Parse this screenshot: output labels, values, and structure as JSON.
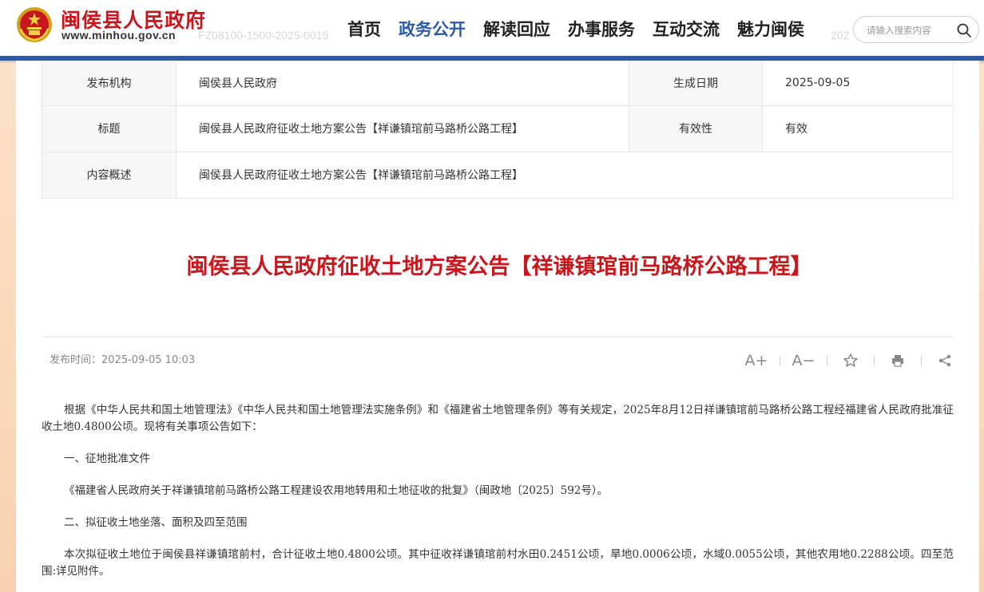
{
  "header": {
    "site_name": "闽侯县人民政府",
    "site_url": "www.minhou.gov.cn",
    "doc_ghost": "FZ08100-1500-2025-0015",
    "doc_ghost_right": "202",
    "nav": [
      "首页",
      "政务公开",
      "解读回应",
      "办事服务",
      "互动交流",
      "魅力闽侯"
    ],
    "active_nav": "政务公开",
    "search_placeholder": "请输入搜索内容",
    "brand_color": "#c8161d",
    "accent_color": "#2c5aa6"
  },
  "meta": {
    "publisher_label": "发布机构",
    "publisher": "闽侯县人民政府",
    "date_label": "生成日期",
    "date": "2025-09-05",
    "title_label": "标题",
    "title": "闽侯县人民政府征收土地方案公告【祥谦镇琯前马路桥公路工程】",
    "validity_label": "有效性",
    "validity": "有效",
    "summary_label": "内容概述",
    "summary": "闽侯县人民政府征收土地方案公告【祥谦镇琯前马路桥公路工程】"
  },
  "article": {
    "heading": "闽侯县人民政府征收土地方案公告【祥谦镇琯前马路桥公路工程】",
    "publish_time": "发布时间：2025-09-05 10:03",
    "tools": {
      "font_up": "A+",
      "font_down": "A−",
      "icons": [
        "font-increase-icon",
        "font-decrease-icon",
        "star-icon",
        "print-icon",
        "share-icon"
      ]
    },
    "paragraphs": [
      "根据《中华人民共和国土地管理法》《中华人民共和国土地管理法实施条例》和《福建省土地管理条例》等有关规定，2025年8月12日祥谦镇琯前马路桥公路工程经福建省人民政府批准征收土地0.4800公顷。现将有关事项公告如下：",
      "一、征地批准文件",
      "《福建省人民政府关于祥谦镇琯前马路桥公路工程建设农用地转用和土地征收的批复》（闽政地〔2025〕592号）。",
      "二、拟征收土地坐落、面积及四至范围",
      "本次拟征收土地位于闽侯县祥谦镇琯前村，合计征收土地0.4800公顷。其中征收祥谦镇琯前村水田0.2451公顷，旱地0.0006公顷，水域0.0055公顷，其他农用地0.2288公顷。四至范围:详见附件。"
    ]
  }
}
